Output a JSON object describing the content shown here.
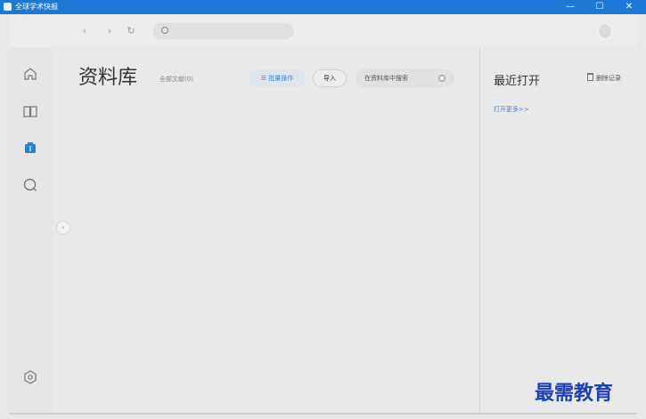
{
  "window": {
    "title": "全球学术快报",
    "controls": [
      "—",
      "☐",
      "✕"
    ]
  },
  "navbar": {
    "back_icon": "chevron-left-icon",
    "forward_icon": "chevron-right-icon",
    "refresh_icon": "refresh-icon",
    "search_icon": "search-icon",
    "search_placeholder": ""
  },
  "sidebar": {
    "items": [
      {
        "name": "home",
        "icon": "home-icon"
      },
      {
        "name": "book",
        "icon": "book-icon"
      },
      {
        "name": "library",
        "icon": "library-icon",
        "active": true
      },
      {
        "name": "search",
        "icon": "search-icon"
      },
      {
        "name": "settings",
        "icon": "settings-icon"
      }
    ]
  },
  "main": {
    "title": "资料库",
    "subtitle": "全部文献(0)",
    "batch_label": "批量操作",
    "import_label": "导入",
    "search_placeholder": "在资料库中搜索"
  },
  "recent": {
    "title": "最近打开",
    "clear_label": "删除记录",
    "more_label": "打开更多>>"
  },
  "watermark": "最需教育",
  "colors": {
    "titlebar": "#1b7ad6",
    "accent": "#3d86d4",
    "background": "#e9e9e9"
  }
}
